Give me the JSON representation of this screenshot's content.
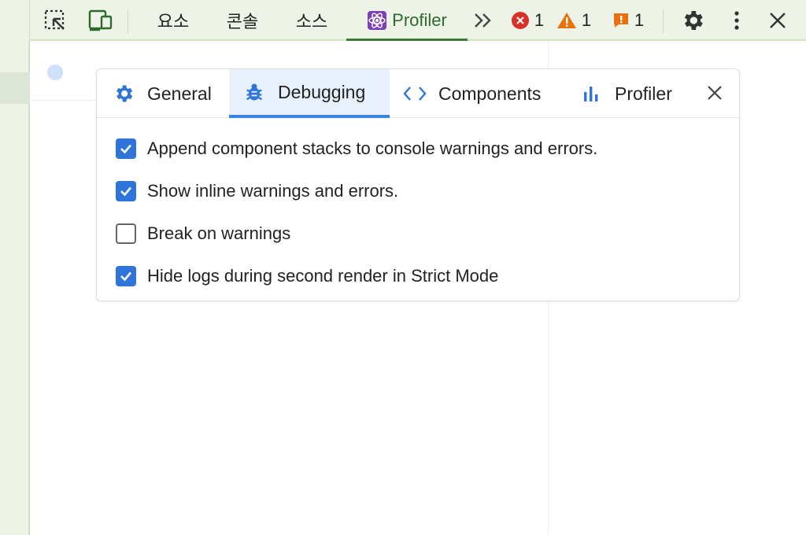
{
  "devtools": {
    "tabs": [
      {
        "label": "요소"
      },
      {
        "label": "콘솔"
      },
      {
        "label": "소스"
      },
      {
        "label": "Profiler"
      }
    ],
    "errors_count": "1",
    "warnings_count": "1",
    "issues_count": "1",
    "colors": {
      "error": "#d93025",
      "warning": "#e8710a",
      "issue": "#e8710a",
      "accent": "#3b82e6"
    }
  },
  "dialog": {
    "tabs": [
      {
        "label": "General",
        "icon": "gear-icon"
      },
      {
        "label": "Debugging",
        "icon": "bug-icon"
      },
      {
        "label": "Components",
        "icon": "code-icon"
      },
      {
        "label": "Profiler",
        "icon": "bar-chart-icon"
      }
    ],
    "selected_tab": "Debugging",
    "options": [
      {
        "label": "Append component stacks to console warnings and errors.",
        "checked": true
      },
      {
        "label": "Show inline warnings and errors.",
        "checked": true
      },
      {
        "label": "Break on warnings",
        "checked": false
      },
      {
        "label": "Hide logs during second render in Strict Mode",
        "checked": true
      }
    ]
  }
}
